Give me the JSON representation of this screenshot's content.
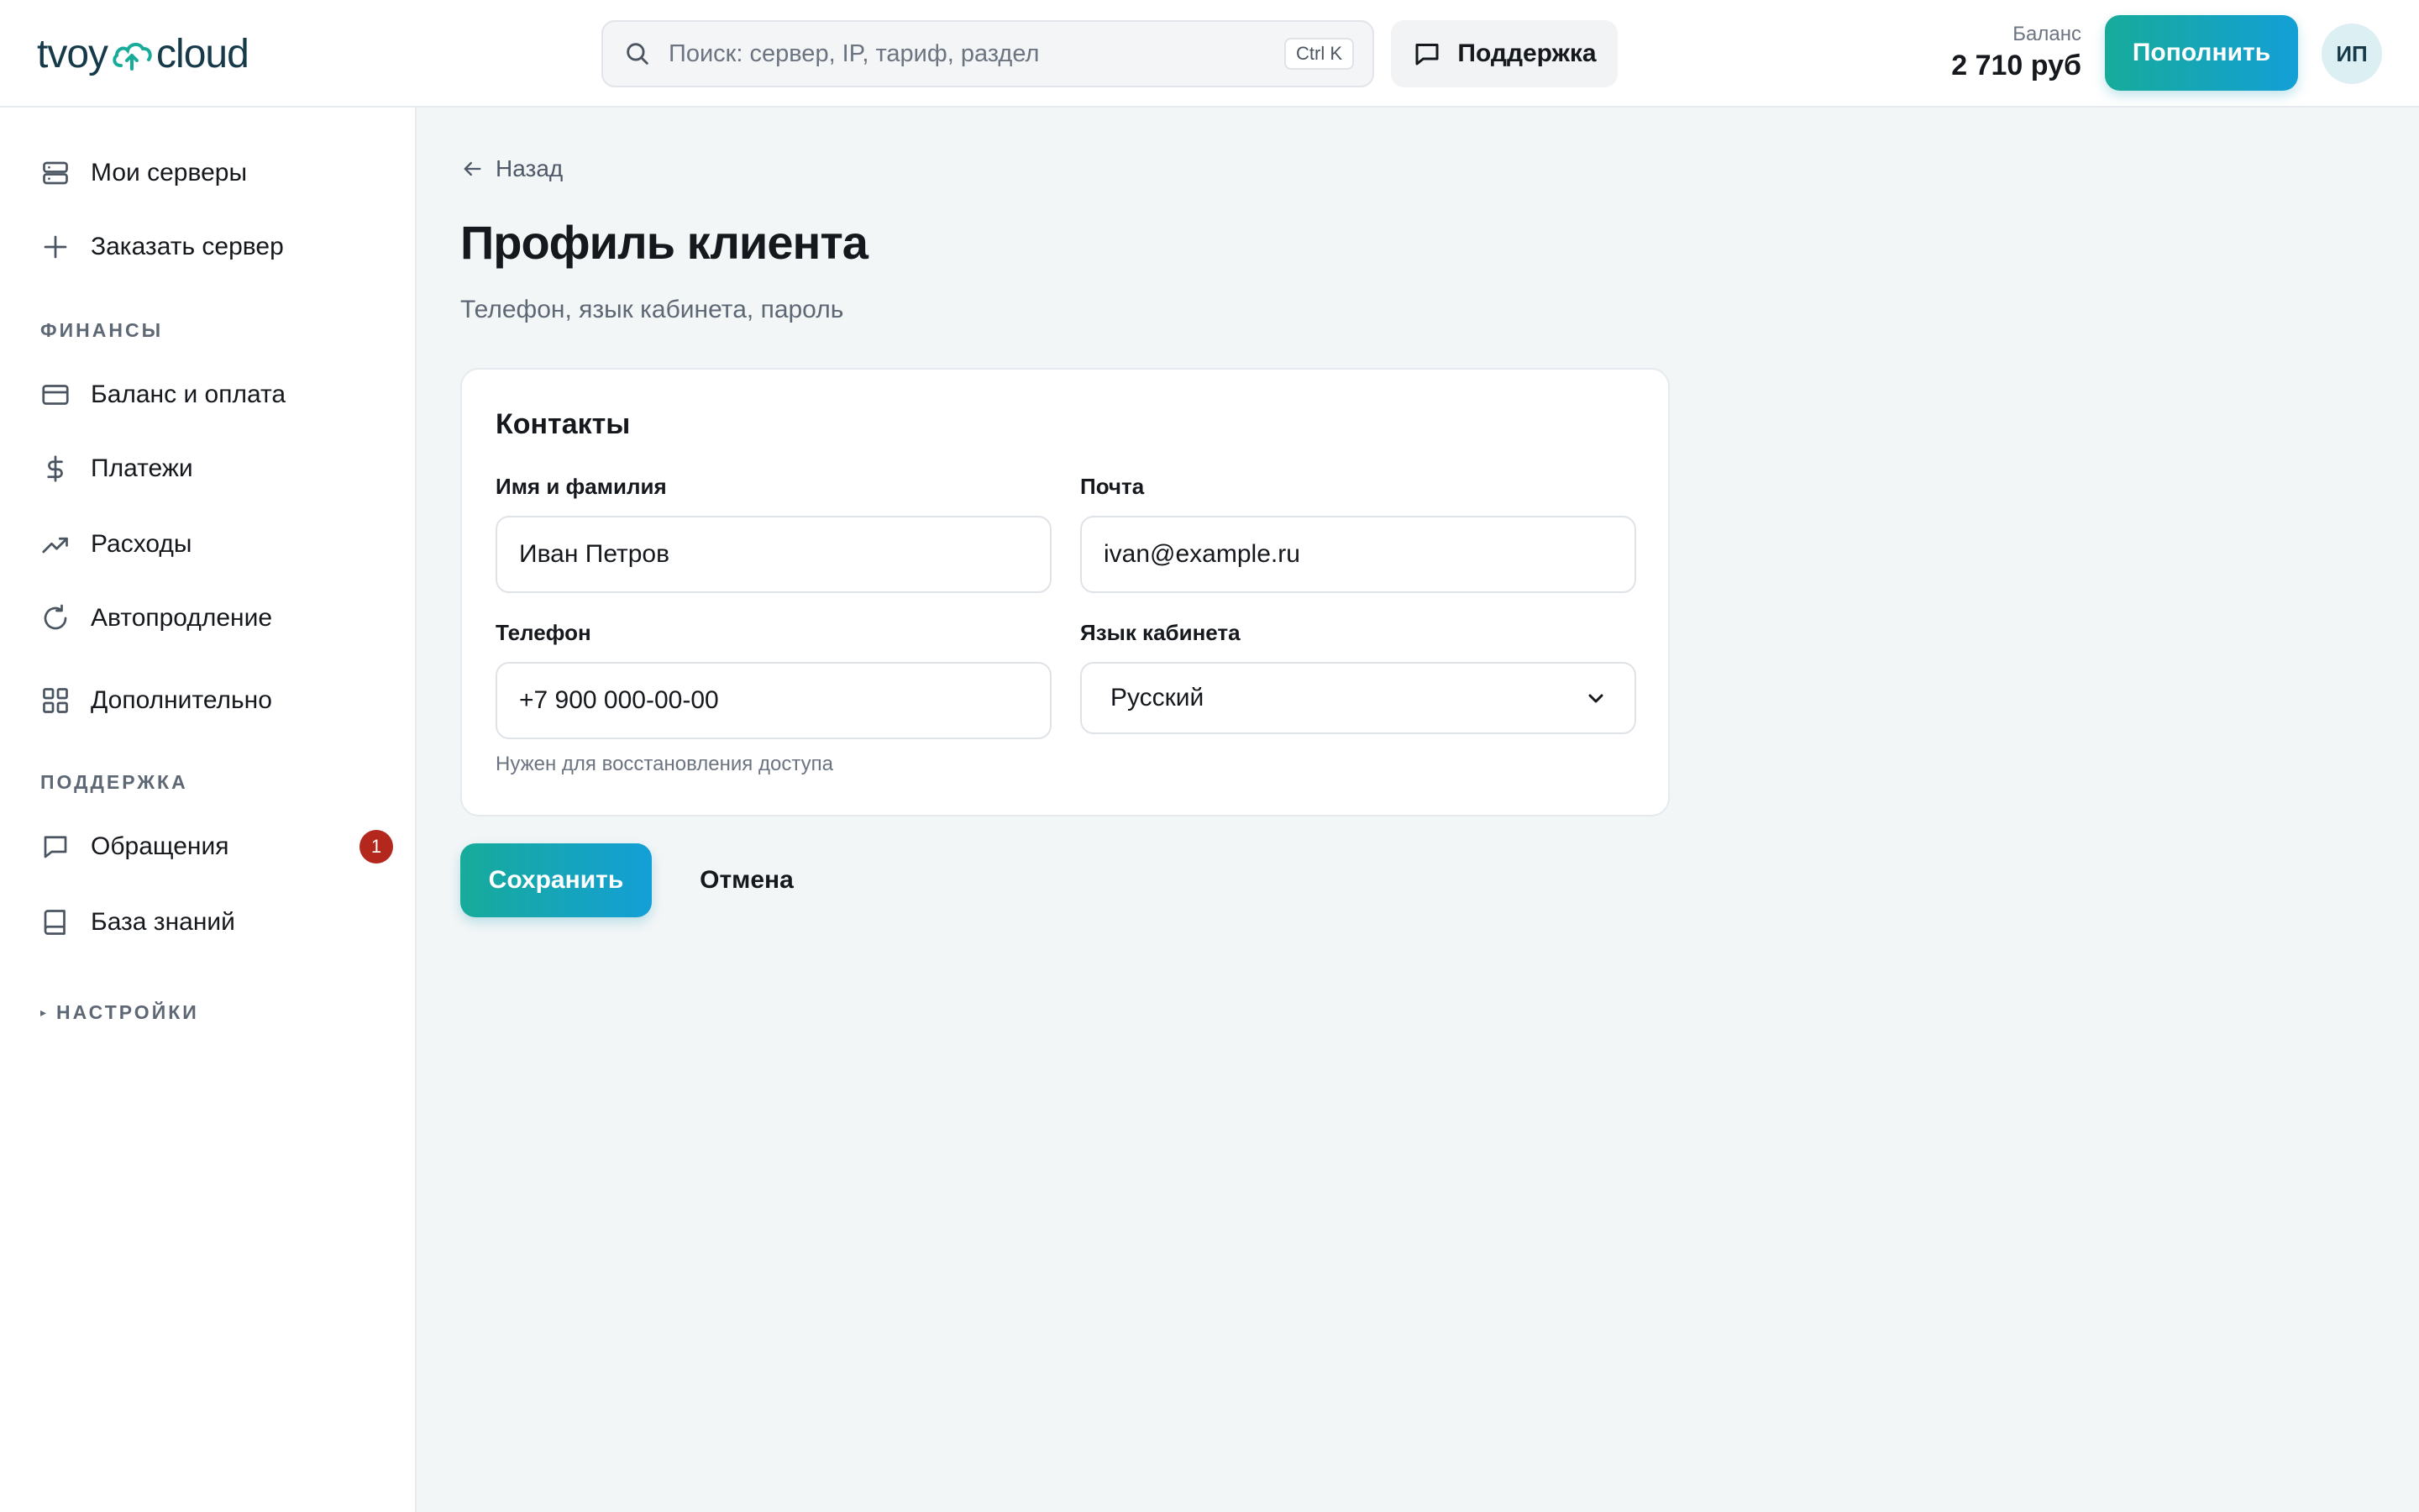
{
  "header": {
    "logo_left": "tvoy",
    "logo_right": "cloud",
    "search_placeholder": "Поиск: сервер, IP, тариф, раздел",
    "search_shortcut": "Ctrl K",
    "support_label": "Поддержка",
    "balance_label": "Баланс",
    "balance_value": "2 710 руб",
    "topup_label": "Пополнить",
    "avatar_initials": "ИП"
  },
  "sidebar": {
    "items": [
      {
        "label": "Мои серверы",
        "icon": "server-icon"
      },
      {
        "label": "Заказать сервер",
        "icon": "plus-icon"
      }
    ],
    "finance_section": "ФИНАНСЫ",
    "finance_items": [
      {
        "label": "Баланс и оплата",
        "icon": "credit-card-icon"
      },
      {
        "label": "Платежи",
        "icon": "dollar-icon"
      },
      {
        "label": "Расходы",
        "icon": "trending-up-icon"
      },
      {
        "label": "Автопродление",
        "icon": "refresh-icon"
      },
      {
        "label": "Дополнительно",
        "icon": "grid-icon"
      }
    ],
    "support_section": "ПОДДЕРЖКА",
    "support_items": [
      {
        "label": "Обращения",
        "icon": "message-icon",
        "badge": "1"
      },
      {
        "label": "База знаний",
        "icon": "book-icon"
      }
    ],
    "settings_section": "НАСТРОЙКИ"
  },
  "main": {
    "back_label": "Назад",
    "title": "Профиль клиента",
    "subtitle": "Телефон, язык кабинета, пароль",
    "card": {
      "title": "Контакты",
      "name_label": "Имя и фамилия",
      "name_value": "Иван Петров",
      "email_label": "Почта",
      "email_value": "ivan@example.ru",
      "phone_label": "Телефон",
      "phone_value": "+7 900 000-00-00",
      "phone_hint": "Нужен для восстановления доступа",
      "lang_label": "Язык кабинета",
      "lang_value": "Русский"
    },
    "save_label": "Сохранить",
    "cancel_label": "Отмена"
  },
  "colors": {
    "accent_start": "#17ab9a",
    "accent_end": "#149fd6",
    "badge": "#b4271c",
    "background": "#f3f6f7"
  }
}
